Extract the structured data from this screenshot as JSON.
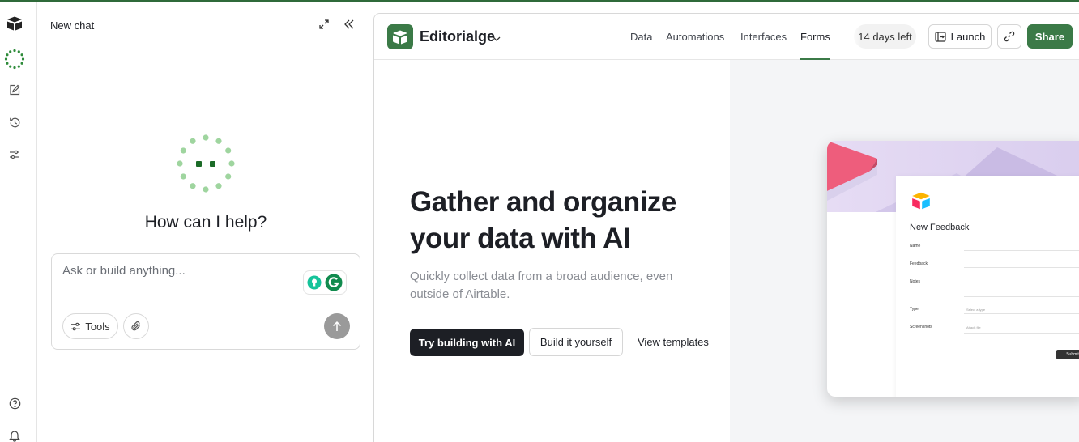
{
  "chat": {
    "title": "New chat",
    "greeting": "How can I help?",
    "input_placeholder": "Ask or build anything...",
    "tools_label": "Tools"
  },
  "topbar": {
    "base_name": "Editorialge",
    "tabs": [
      {
        "label": "Data",
        "active": false
      },
      {
        "label": "Automations",
        "active": false
      },
      {
        "label": "Interfaces",
        "active": false
      },
      {
        "label": "Forms",
        "active": true
      }
    ],
    "trial_label": "14 days left",
    "launch_label": "Launch",
    "share_label": "Share"
  },
  "hero": {
    "headline": "Gather and organize your data with AI",
    "subtext": "Quickly collect data from a broad audience, even outside of Airtable.",
    "primary_cta": "Try building with AI",
    "secondary_cta": "Build it yourself",
    "link_cta": "View templates"
  },
  "preview_form": {
    "title": "New Feedback",
    "fields": [
      {
        "label": "Name",
        "hint": ""
      },
      {
        "label": "Feedback",
        "hint": ""
      },
      {
        "label": "Notes",
        "hint": ""
      },
      {
        "label": "Type",
        "hint": "Select a type"
      },
      {
        "label": "Screenshots",
        "hint": "Attach file"
      }
    ],
    "submit_label": "Submit"
  },
  "colors": {
    "brand_green": "#3b7a47",
    "dark_button": "#1d1f25",
    "muted_text": "#898c93",
    "right_panel_bg": "#f4f5f7"
  },
  "icons": {
    "rail": [
      "airtable-logo-icon",
      "omni-ai-icon",
      "edit-icon",
      "history-icon",
      "sliders-icon",
      "help-icon",
      "bell-icon"
    ],
    "chat_header": [
      "expand-icon",
      "collapse-sidebar-icon"
    ],
    "composer": [
      "grammarly-icon",
      "sliders-icon",
      "paperclip-icon",
      "arrow-up-icon"
    ],
    "topbar": [
      "base-logo-icon",
      "chevron-down-icon",
      "launch-icon",
      "link-icon"
    ]
  }
}
